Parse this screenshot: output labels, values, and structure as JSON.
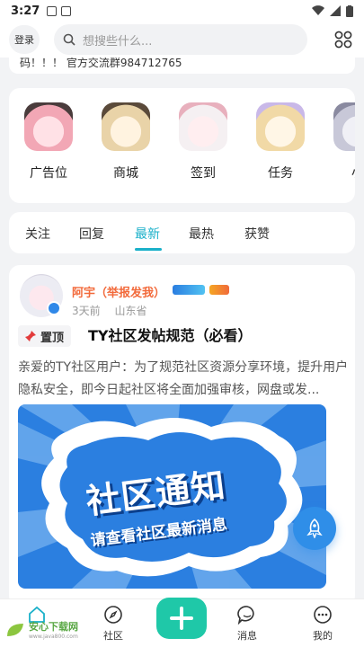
{
  "status_bar": {
    "time": "3:27"
  },
  "header": {
    "login_label": "登录",
    "search_placeholder": "想搜些什么..."
  },
  "notice_text": "码！！！ 官方交流群984712765",
  "quick_menu": [
    {
      "label": "广告位"
    },
    {
      "label": "商城"
    },
    {
      "label": "签到"
    },
    {
      "label": "任务"
    },
    {
      "label": "小"
    }
  ],
  "tabs": [
    {
      "label": "关注"
    },
    {
      "label": "回复"
    },
    {
      "label": "最新",
      "active": true
    },
    {
      "label": "最热"
    },
    {
      "label": "获赞"
    }
  ],
  "post": {
    "author": "阿宇（举报发我）",
    "time": "3天前",
    "location": "山东省",
    "pin_label": "置顶",
    "title": "TY社区发帖规范（必看）",
    "excerpt": "亲爱的TY社区用户：为了规范社区资源分享环境，提升用户隐私安全，即今日起社区将全面加强审核，网盘或发...",
    "banner_title": "社区通知",
    "banner_subtitle": "请查看社区最新消息"
  },
  "bottom_nav": [
    {
      "label": "首页"
    },
    {
      "label": "社区"
    },
    {
      "label": "消息"
    },
    {
      "label": "我的"
    }
  ],
  "watermark": {
    "title": "安心下载网",
    "url": "www.java800.com"
  },
  "colors": {
    "accent": "#1ab0c9",
    "author": "#f26a3b",
    "plus_button": "#1fc8a8",
    "fab": "#2f8ee8"
  }
}
